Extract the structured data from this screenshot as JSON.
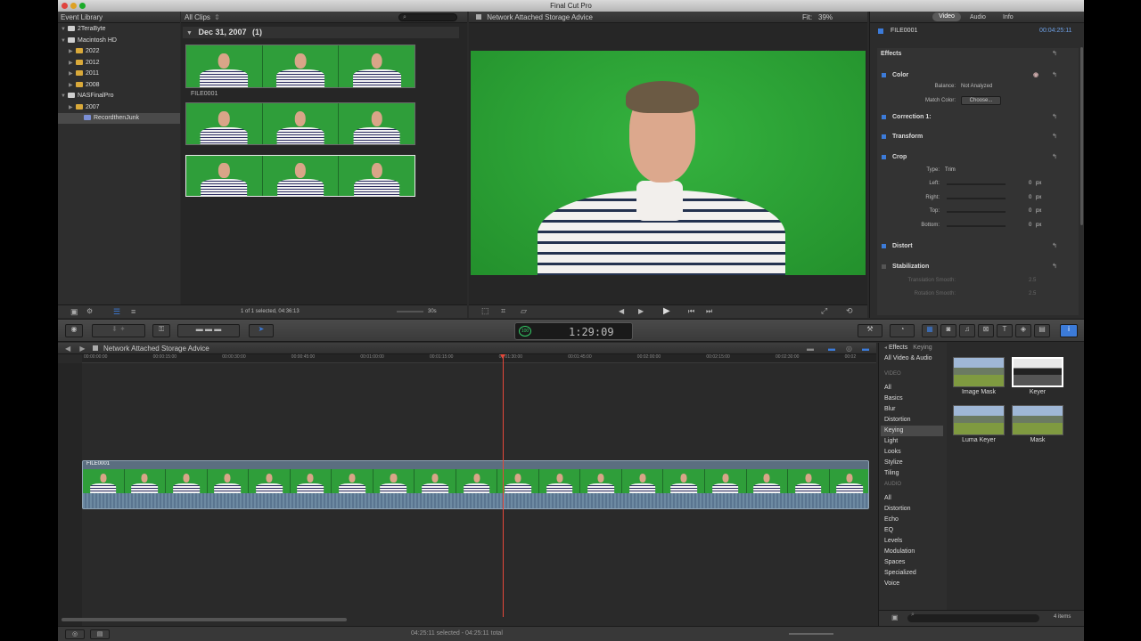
{
  "app": {
    "title": "Final Cut Pro"
  },
  "library": {
    "header": "Event Library",
    "items": [
      {
        "label": "2TeraByte",
        "indent": 0,
        "type": "drive"
      },
      {
        "label": "Macintosh HD",
        "indent": 0,
        "type": "drive"
      },
      {
        "label": "2022",
        "indent": 1,
        "type": "folder"
      },
      {
        "label": "2012",
        "indent": 1,
        "type": "folder"
      },
      {
        "label": "2011",
        "indent": 1,
        "type": "folder"
      },
      {
        "label": "2008",
        "indent": 1,
        "type": "folder"
      },
      {
        "label": "NASFinalPro",
        "indent": 0,
        "type": "drive"
      },
      {
        "label": "2007",
        "indent": 1,
        "type": "folder"
      },
      {
        "label": "RecordthenJunk",
        "indent": 2,
        "type": "event"
      }
    ]
  },
  "browser": {
    "filter": "All Clips",
    "group_label": "Dec 31, 2007",
    "group_count": "(1)",
    "clip_name": "FILE0001",
    "footer_status": "1 of 1 selected, 04:36:13",
    "zoom": "30s"
  },
  "viewer": {
    "title": "Network Attached Storage Advice",
    "fit_label": "Fit:",
    "fit_value": "39%"
  },
  "inspector": {
    "tabs": [
      "Video",
      "Audio",
      "Info"
    ],
    "clip_name": "FILE0001",
    "duration": "00:04:25:11",
    "effects_label": "Effects",
    "color_label": "Color",
    "balance_label": "Balance:",
    "balance_value": "Not Analyzed",
    "match_color_label": "Match Color:",
    "match_color_button": "Choose...",
    "correction_label": "Correction 1:",
    "transform_label": "Transform",
    "crop_label": "Crop",
    "crop_type_label": "Type:",
    "crop_type_value": "Trim",
    "crop_rows": [
      {
        "label": "Left:",
        "value": "0",
        "unit": "px"
      },
      {
        "label": "Right:",
        "value": "0",
        "unit": "px"
      },
      {
        "label": "Top:",
        "value": "0",
        "unit": "px"
      },
      {
        "label": "Bottom:",
        "value": "0",
        "unit": "px"
      }
    ],
    "distort_label": "Distort",
    "stabilization_label": "Stabilization",
    "translation_smooth_label": "Translation Smooth:",
    "translation_smooth_value": "2.5",
    "rotation_smooth_label": "Rotation Smooth:",
    "rotation_smooth_value": "2.5"
  },
  "toolbar": {
    "timecode": "1:29:09",
    "timecode_prefix": "100"
  },
  "timeline": {
    "project_name": "Network Attached Storage Advice",
    "ruler": [
      "00:00:00:00",
      "00:00:15:00",
      "00:00:30:00",
      "00:00:45:00",
      "00:01:00:00",
      "00:01:15:00",
      "00:01:30:00",
      "00:01:45:00",
      "00:02:00:00",
      "00:02:15:00",
      "00:02:30:00",
      "00:02"
    ],
    "clip_name": "FILE0001",
    "playhead_fraction": 0.529,
    "status": "04:25:11 selected - 04:25:11 total"
  },
  "effects_browser": {
    "title": "Effects",
    "subtitle": "Keying",
    "all_label": "All Video & Audio",
    "video_header": "VIDEO",
    "video_categories": [
      "All",
      "Basics",
      "Blur",
      "Distortion",
      "Keying",
      "Light",
      "Looks",
      "Stylize",
      "Tiling"
    ],
    "selected_category": "Keying",
    "audio_header": "AUDIO",
    "audio_categories": [
      "All",
      "Distortion",
      "Echo",
      "EQ",
      "Levels",
      "Modulation",
      "Spaces",
      "Specialized",
      "Voice"
    ],
    "items": [
      "Image Mask",
      "Keyer",
      "Luma Keyer",
      "Mask"
    ],
    "count_label": "4 items"
  },
  "colors": {
    "accent": "#3c7bd9",
    "green_screen": "#2f9e3a",
    "playhead": "#e5483a"
  }
}
